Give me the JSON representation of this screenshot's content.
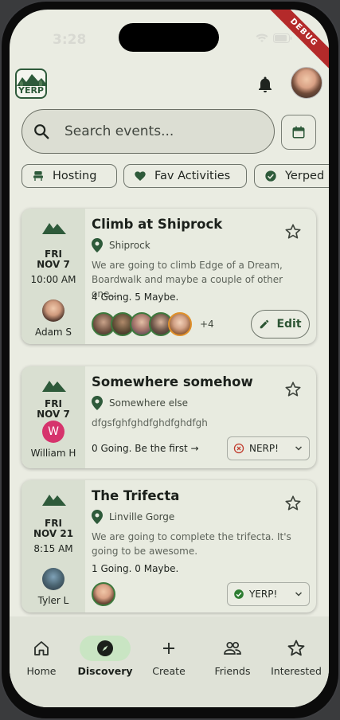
{
  "status_bar": {
    "time": "3:28",
    "debug_banner": "DEBUG"
  },
  "header": {
    "logo_text": "YERP"
  },
  "search": {
    "placeholder": "Search events..."
  },
  "filters": [
    {
      "label": "Hosting",
      "icon": "host-icon"
    },
    {
      "label": "Fav Activities",
      "icon": "heart-icon"
    },
    {
      "label": "Yerped",
      "icon": "check-circle-icon"
    }
  ],
  "events": [
    {
      "day_of_week": "FRI",
      "date": "NOV 7",
      "time": "10:00 AM",
      "host": "Adam S",
      "title": "Climb at Shiprock",
      "location": "Shiprock",
      "description": "We are going to climb Edge of a Dream, Boardwalk and maybe a couple of other one…",
      "attendance": "4 Going. 5 Maybe.",
      "more_attendees": "+4",
      "action": "Edit"
    },
    {
      "day_of_week": "FRI",
      "date": "NOV 7",
      "host_initial": "W",
      "host": "William H",
      "title": "Somewhere somehow",
      "location": "Somewhere else",
      "description": "dfgsfghfghdfghdfghdfgh",
      "attendance": "0 Going. Be the first →",
      "rsvp": "NERP!"
    },
    {
      "day_of_week": "FRI",
      "date": "NOV 21",
      "time": "8:15 AM",
      "host": "Tyler L",
      "title": "The Trifecta",
      "location": "Linville Gorge",
      "description": "We are going to complete the trifecta. It's going to be awesome.",
      "attendance": "1 Going. 0 Maybe.",
      "rsvp": "YERP!"
    }
  ],
  "nav": [
    {
      "label": "Home",
      "icon": "home-icon"
    },
    {
      "label": "Discovery",
      "icon": "compass-icon",
      "active": true
    },
    {
      "label": "Create",
      "icon": "plus-icon"
    },
    {
      "label": "Friends",
      "icon": "people-icon"
    },
    {
      "label": "Interested",
      "icon": "star-icon"
    }
  ],
  "colors": {
    "accent": "#2e5a3a",
    "background": "#eaece2",
    "nerp": "#c0392b",
    "yerp": "#2e7d32",
    "maybe_ring": "#e0902a"
  }
}
